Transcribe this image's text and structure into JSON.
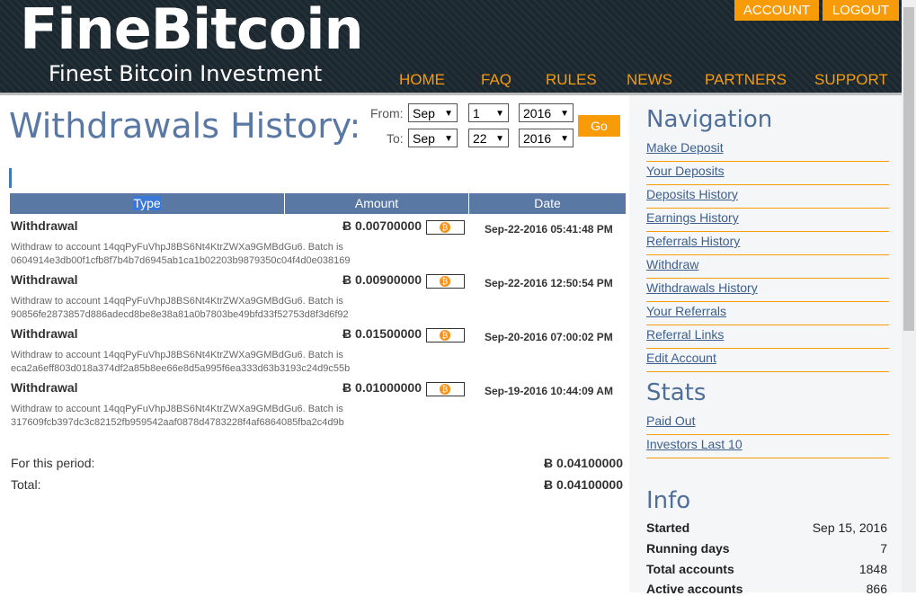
{
  "header": {
    "logo": "FineBitcoin",
    "tagline": "Finest Bitcoin Investment",
    "account_label": "ACCOUNT",
    "logout_label": "LOGOUT",
    "nav": [
      "HOME",
      "FAQ",
      "RULES",
      "NEWS",
      "PARTNERS",
      "SUPPORT"
    ]
  },
  "main": {
    "title": "Withdrawals History:",
    "filter": {
      "from_label": "From:",
      "to_label": "To:",
      "from": {
        "month": "Sep",
        "day": "1",
        "year": "2016"
      },
      "to": {
        "month": "Sep",
        "day": "22",
        "year": "2016"
      },
      "go_label": "Go"
    },
    "columns": [
      "Type",
      "Amount",
      "Date"
    ],
    "rows": [
      {
        "type": "Withdrawal",
        "amount": "Ƀ 0.00700000",
        "date": "Sep-22-2016 05:41:48 PM",
        "desc": "Withdraw to account 14qqPyFuVhpJ8BS6Nt4KtrZWXa9GMBdGu6. Batch is 0604914e3db00f1cfb8f7b4b7d6945ab1ca1b02203b9879350c04f4d0e038169"
      },
      {
        "type": "Withdrawal",
        "amount": "Ƀ 0.00900000",
        "date": "Sep-22-2016 12:50:54 PM",
        "desc": "Withdraw to account 14qqPyFuVhpJ8BS6Nt4KtrZWXa9GMBdGu6. Batch is 90856fe2873857d886adecd8be8e38a81a0b7803be49bfd33f52753d8f3d6f92"
      },
      {
        "type": "Withdrawal",
        "amount": "Ƀ 0.01500000",
        "date": "Sep-20-2016 07:00:02 PM",
        "desc": "Withdraw to account 14qqPyFuVhpJ8BS6Nt4KtrZWXa9GMBdGu6. Batch is eca2a6eff803d018a374df2a85b8ee66e8d5a995f6ea333d63b3193c24d9c55b"
      },
      {
        "type": "Withdrawal",
        "amount": "Ƀ 0.01000000",
        "date": "Sep-19-2016 10:44:09 AM",
        "desc": "Withdraw to account 14qqPyFuVhpJ8BS6Nt4KtrZWXa9GMBdGu6. Batch is 317609fcb397dc3c82152fb959542aaf0878d4783228f4af6864085fba2c4d9b"
      }
    ],
    "period_label": "For this period:",
    "period_value": "Ƀ 0.04100000",
    "total_label": "Total:",
    "total_value": "Ƀ 0.04100000"
  },
  "sidebar": {
    "nav_title": "Navigation",
    "nav_links": [
      "Make Deposit",
      "Your Deposits",
      "Deposits History",
      "Earnings History",
      "Referrals History",
      "Withdraw",
      "Withdrawals History",
      "Your Referrals",
      "Referral Links",
      "Edit Account"
    ],
    "stats_title": "Stats",
    "stats_links": [
      "Paid Out",
      "Investors Last 10"
    ],
    "info_title": "Info",
    "info": [
      {
        "label": "Started",
        "value": "Sep 15, 2016"
      },
      {
        "label": "Running days",
        "value": "7"
      },
      {
        "label": "Total accounts",
        "value": "1848"
      },
      {
        "label": "Active accounts",
        "value": "866"
      }
    ]
  },
  "colors": {
    "accent": "#f79b09",
    "header_bg": "#1c2830",
    "table_head": "#5a78a4",
    "coin": "#f7931a"
  }
}
